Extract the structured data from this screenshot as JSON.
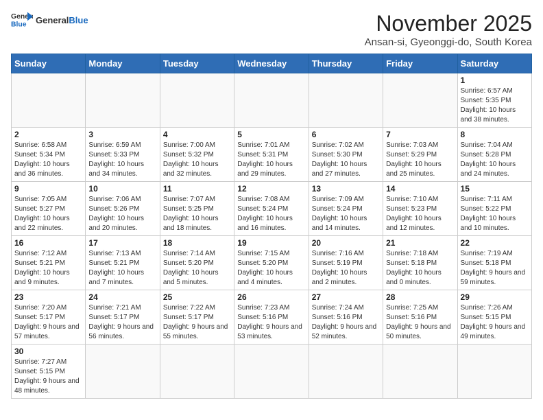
{
  "header": {
    "logo_general": "General",
    "logo_blue": "Blue",
    "title": "November 2025",
    "subtitle": "Ansan-si, Gyeonggi-do, South Korea"
  },
  "days_of_week": [
    "Sunday",
    "Monday",
    "Tuesday",
    "Wednesday",
    "Thursday",
    "Friday",
    "Saturday"
  ],
  "weeks": [
    [
      {
        "day": "",
        "info": ""
      },
      {
        "day": "",
        "info": ""
      },
      {
        "day": "",
        "info": ""
      },
      {
        "day": "",
        "info": ""
      },
      {
        "day": "",
        "info": ""
      },
      {
        "day": "",
        "info": ""
      },
      {
        "day": "1",
        "info": "Sunrise: 6:57 AM\nSunset: 5:35 PM\nDaylight: 10 hours and 38 minutes."
      }
    ],
    [
      {
        "day": "2",
        "info": "Sunrise: 6:58 AM\nSunset: 5:34 PM\nDaylight: 10 hours and 36 minutes."
      },
      {
        "day": "3",
        "info": "Sunrise: 6:59 AM\nSunset: 5:33 PM\nDaylight: 10 hours and 34 minutes."
      },
      {
        "day": "4",
        "info": "Sunrise: 7:00 AM\nSunset: 5:32 PM\nDaylight: 10 hours and 32 minutes."
      },
      {
        "day": "5",
        "info": "Sunrise: 7:01 AM\nSunset: 5:31 PM\nDaylight: 10 hours and 29 minutes."
      },
      {
        "day": "6",
        "info": "Sunrise: 7:02 AM\nSunset: 5:30 PM\nDaylight: 10 hours and 27 minutes."
      },
      {
        "day": "7",
        "info": "Sunrise: 7:03 AM\nSunset: 5:29 PM\nDaylight: 10 hours and 25 minutes."
      },
      {
        "day": "8",
        "info": "Sunrise: 7:04 AM\nSunset: 5:28 PM\nDaylight: 10 hours and 24 minutes."
      }
    ],
    [
      {
        "day": "9",
        "info": "Sunrise: 7:05 AM\nSunset: 5:27 PM\nDaylight: 10 hours and 22 minutes."
      },
      {
        "day": "10",
        "info": "Sunrise: 7:06 AM\nSunset: 5:26 PM\nDaylight: 10 hours and 20 minutes."
      },
      {
        "day": "11",
        "info": "Sunrise: 7:07 AM\nSunset: 5:25 PM\nDaylight: 10 hours and 18 minutes."
      },
      {
        "day": "12",
        "info": "Sunrise: 7:08 AM\nSunset: 5:24 PM\nDaylight: 10 hours and 16 minutes."
      },
      {
        "day": "13",
        "info": "Sunrise: 7:09 AM\nSunset: 5:24 PM\nDaylight: 10 hours and 14 minutes."
      },
      {
        "day": "14",
        "info": "Sunrise: 7:10 AM\nSunset: 5:23 PM\nDaylight: 10 hours and 12 minutes."
      },
      {
        "day": "15",
        "info": "Sunrise: 7:11 AM\nSunset: 5:22 PM\nDaylight: 10 hours and 10 minutes."
      }
    ],
    [
      {
        "day": "16",
        "info": "Sunrise: 7:12 AM\nSunset: 5:21 PM\nDaylight: 10 hours and 9 minutes."
      },
      {
        "day": "17",
        "info": "Sunrise: 7:13 AM\nSunset: 5:21 PM\nDaylight: 10 hours and 7 minutes."
      },
      {
        "day": "18",
        "info": "Sunrise: 7:14 AM\nSunset: 5:20 PM\nDaylight: 10 hours and 5 minutes."
      },
      {
        "day": "19",
        "info": "Sunrise: 7:15 AM\nSunset: 5:20 PM\nDaylight: 10 hours and 4 minutes."
      },
      {
        "day": "20",
        "info": "Sunrise: 7:16 AM\nSunset: 5:19 PM\nDaylight: 10 hours and 2 minutes."
      },
      {
        "day": "21",
        "info": "Sunrise: 7:18 AM\nSunset: 5:18 PM\nDaylight: 10 hours and 0 minutes."
      },
      {
        "day": "22",
        "info": "Sunrise: 7:19 AM\nSunset: 5:18 PM\nDaylight: 9 hours and 59 minutes."
      }
    ],
    [
      {
        "day": "23",
        "info": "Sunrise: 7:20 AM\nSunset: 5:17 PM\nDaylight: 9 hours and 57 minutes."
      },
      {
        "day": "24",
        "info": "Sunrise: 7:21 AM\nSunset: 5:17 PM\nDaylight: 9 hours and 56 minutes."
      },
      {
        "day": "25",
        "info": "Sunrise: 7:22 AM\nSunset: 5:17 PM\nDaylight: 9 hours and 55 minutes."
      },
      {
        "day": "26",
        "info": "Sunrise: 7:23 AM\nSunset: 5:16 PM\nDaylight: 9 hours and 53 minutes."
      },
      {
        "day": "27",
        "info": "Sunrise: 7:24 AM\nSunset: 5:16 PM\nDaylight: 9 hours and 52 minutes."
      },
      {
        "day": "28",
        "info": "Sunrise: 7:25 AM\nSunset: 5:16 PM\nDaylight: 9 hours and 50 minutes."
      },
      {
        "day": "29",
        "info": "Sunrise: 7:26 AM\nSunset: 5:15 PM\nDaylight: 9 hours and 49 minutes."
      }
    ],
    [
      {
        "day": "30",
        "info": "Sunrise: 7:27 AM\nSunset: 5:15 PM\nDaylight: 9 hours and 48 minutes."
      },
      {
        "day": "",
        "info": ""
      },
      {
        "day": "",
        "info": ""
      },
      {
        "day": "",
        "info": ""
      },
      {
        "day": "",
        "info": ""
      },
      {
        "day": "",
        "info": ""
      },
      {
        "day": "",
        "info": ""
      }
    ]
  ]
}
